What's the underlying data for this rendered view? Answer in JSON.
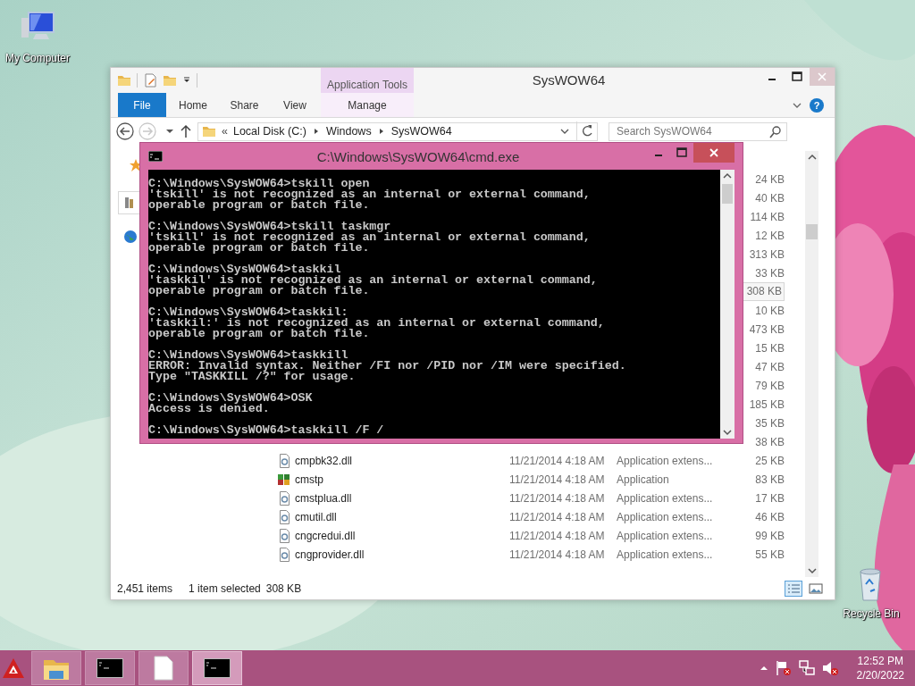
{
  "desktop_icons": [
    {
      "label": "My Computer",
      "kind": "computer"
    },
    {
      "label": "Recycle Bin",
      "kind": "recycle"
    }
  ],
  "explorer": {
    "title": "SysWOW64",
    "context_tab": "Application Tools",
    "help": "?",
    "ribbon_tabs": [
      {
        "label": "File",
        "kind": "file"
      },
      {
        "label": "Home",
        "kind": "plain"
      },
      {
        "label": "Share",
        "kind": "plain"
      },
      {
        "label": "View",
        "kind": "plain"
      },
      {
        "label": "Manage",
        "kind": "context"
      }
    ],
    "address": {
      "overflow_mark": "«",
      "breadcrumb": [
        "Local Disk (C:)",
        "Windows",
        "SysWOW64"
      ]
    },
    "search": {
      "placeholder": "Search SysWOW64"
    },
    "files": [
      {
        "size": "24 KB",
        "selected": false
      },
      {
        "size": "40 KB",
        "selected": false
      },
      {
        "size": "114 KB",
        "selected": false
      },
      {
        "size": "12 KB",
        "selected": false
      },
      {
        "size": "313 KB",
        "selected": false
      },
      {
        "size": "33 KB",
        "selected": false
      },
      {
        "size": "308 KB",
        "selected": true
      },
      {
        "size": "10 KB",
        "selected": false
      },
      {
        "size": "473 KB",
        "selected": false
      },
      {
        "size": "15 KB",
        "selected": false
      },
      {
        "size": "47 KB",
        "selected": false
      },
      {
        "size": "79 KB",
        "selected": false
      },
      {
        "size": "185 KB",
        "selected": false
      },
      {
        "size": "35 KB",
        "selected": false
      },
      {
        "size": "38 KB",
        "selected": false
      },
      {
        "name": "cmpbk32.dll",
        "kind": "dll",
        "date": "11/21/2014 4:18 AM",
        "type": "Application extens...",
        "size": "25 KB",
        "selected": false
      },
      {
        "name": "cmstp",
        "kind": "app",
        "date": "11/21/2014 4:18 AM",
        "type": "Application",
        "size": "83 KB",
        "selected": false
      },
      {
        "name": "cmstplua.dll",
        "kind": "dll",
        "date": "11/21/2014 4:18 AM",
        "type": "Application extens...",
        "size": "17 KB",
        "selected": false
      },
      {
        "name": "cmutil.dll",
        "kind": "dll",
        "date": "11/21/2014 4:18 AM",
        "type": "Application extens...",
        "size": "46 KB",
        "selected": false
      },
      {
        "name": "cngcredui.dll",
        "kind": "dll",
        "date": "11/21/2014 4:18 AM",
        "type": "Application extens...",
        "size": "99 KB",
        "selected": false
      },
      {
        "name": "cngprovider.dll",
        "kind": "dll",
        "date": "11/21/2014 4:18 AM",
        "type": "Application extens...",
        "size": "55 KB",
        "selected": false
      }
    ],
    "status": {
      "items": "2,451 items",
      "selection": "1 item selected",
      "selection_size": "308 KB"
    }
  },
  "console": {
    "title": "C:\\Windows\\SysWOW64\\cmd.exe",
    "blocks": [
      [
        "C:\\Windows\\SysWOW64>tskill open",
        "'tskill' is not recognized as an internal or external command,",
        "operable program or batch file."
      ],
      [
        "C:\\Windows\\SysWOW64>tskill taskmgr",
        "'tskill' is not recognized as an internal or external command,",
        "operable program or batch file."
      ],
      [
        "C:\\Windows\\SysWOW64>taskkil",
        "'taskkil' is not recognized as an internal or external command,",
        "operable program or batch file."
      ],
      [
        "C:\\Windows\\SysWOW64>taskkil:",
        "'taskkil:' is not recognized as an internal or external command,",
        "operable program or batch file."
      ],
      [
        "C:\\Windows\\SysWOW64>taskkill",
        "ERROR: Invalid syntax. Neither /FI nor /PID nor /IM were specified.",
        "Type \"TASKKILL /?\" for usage."
      ],
      [
        "C:\\Windows\\SysWOW64>OSK",
        "Access is denied."
      ],
      [
        "C:\\Windows\\SysWOW64>taskkill /F /"
      ]
    ]
  },
  "taskbar": {
    "items": [
      {
        "kind": "explorer",
        "selected": false
      },
      {
        "kind": "console",
        "selected": false
      },
      {
        "kind": "document",
        "selected": false
      },
      {
        "kind": "console",
        "selected": true
      }
    ],
    "clock": {
      "time": "12:52 PM",
      "date": "2/20/2022"
    }
  }
}
